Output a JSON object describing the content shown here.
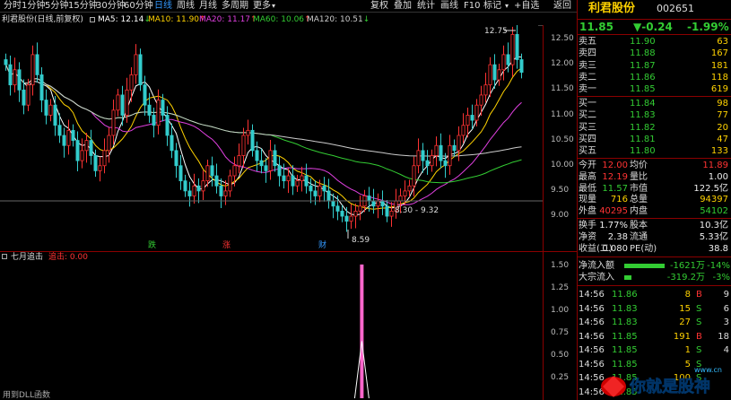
{
  "toolbar": {
    "tabs": [
      "分时",
      "1分钟",
      "5分钟",
      "15分钟",
      "30分钟",
      "60分钟",
      "日线",
      "周线",
      "月线",
      "多周期",
      "更多"
    ],
    "active_tab": "日线",
    "buttons": [
      "复权",
      "叠加",
      "统计",
      "画线",
      "F10",
      "标记",
      "+自选",
      "返回"
    ]
  },
  "chart": {
    "title": "利君股份(日线,前复权)",
    "ma": [
      {
        "label": "MA5: 12.14",
        "arrow": "↓",
        "color": "#ffffff"
      },
      {
        "label": "MA10: 11.90",
        "arrow": "↑",
        "color": "#ffd200"
      },
      {
        "label": "MA20: 11.17",
        "arrow": "↑",
        "color": "#e040e0"
      },
      {
        "label": "MA60: 10.06",
        "arrow": "↑",
        "color": "#33cc33"
      },
      {
        "label": "MA120: 10.51",
        "arrow": "↓",
        "color": "#cccccc"
      }
    ],
    "yaxis": [
      "12.50",
      "12.00",
      "11.50",
      "11.00",
      "10.50",
      "10.00",
      "9.50",
      "9.00"
    ],
    "annotations": {
      "high": "12.75",
      "low": "8.59",
      "range": "8.30 - 9.32"
    },
    "markers": [
      {
        "text": "跌",
        "color": "#33cc33"
      },
      {
        "text": "涨",
        "color": "#ff3333"
      },
      {
        "text": "财",
        "color": "#3399ff"
      }
    ]
  },
  "indicator": {
    "name": "七月追击",
    "label": "追击: 0.00",
    "yaxis": [
      "1.50",
      "1.25",
      "1.00",
      "0.75",
      "0.50",
      "0.25"
    ],
    "footer": "用到DLL函数"
  },
  "panel": {
    "name": "利君股份",
    "code": "002651",
    "price": "11.85",
    "change": "▼-0.24",
    "pct": "-1.99%",
    "asks": [
      {
        "label": "卖五",
        "price": "11.90",
        "vol": "63"
      },
      {
        "label": "卖四",
        "price": "11.88",
        "vol": "167"
      },
      {
        "label": "卖三",
        "price": "11.87",
        "vol": "181"
      },
      {
        "label": "卖二",
        "price": "11.86",
        "vol": "118"
      },
      {
        "label": "卖一",
        "price": "11.85",
        "vol": "619"
      }
    ],
    "bids": [
      {
        "label": "买一",
        "price": "11.84",
        "vol": "98"
      },
      {
        "label": "买二",
        "price": "11.83",
        "vol": "77"
      },
      {
        "label": "买三",
        "price": "11.82",
        "vol": "20"
      },
      {
        "label": "买四",
        "price": "11.81",
        "vol": "47"
      },
      {
        "label": "买五",
        "price": "11.80",
        "vol": "133"
      }
    ],
    "stats": [
      {
        "l1": "今开",
        "v1": "12.00",
        "c1": "#ff3333",
        "l2": "均价",
        "v2": "11.89",
        "c2": "#ff3333"
      },
      {
        "l1": "最高",
        "v1": "12.19",
        "c1": "#ff3333",
        "l2": "量比",
        "v2": "1.00",
        "c2": "#eeeeee"
      },
      {
        "l1": "最低",
        "v1": "11.57",
        "c1": "#33cc33",
        "l2": "市值",
        "v2": "122.5亿",
        "c2": "#eeeeee"
      },
      {
        "l1": "现量",
        "v1": "716",
        "c1": "#ffd200",
        "l2": "总量",
        "v2": "94397",
        "c2": "#ffd200"
      },
      {
        "l1": "外盘",
        "v1": "40295",
        "c1": "#ff3333",
        "l2": "内盘",
        "v2": "54102",
        "c2": "#33cc33"
      }
    ],
    "stats2": [
      {
        "l1": "换手",
        "v1": "1.77%",
        "l2": "股本",
        "v2": "10.3亿"
      },
      {
        "l1": "净资",
        "v1": "2.38",
        "l2": "流通",
        "v2": "5.33亿"
      },
      {
        "l1": "收益(二)",
        "v1": "0.080",
        "l2": "PE(动)",
        "v2": "38.8"
      }
    ],
    "flows": [
      {
        "label": "净流入额",
        "value": "-1621万",
        "pct": "-14%",
        "bar": 0.8
      },
      {
        "label": "大宗流入",
        "value": "-319.2万",
        "pct": "-3%",
        "bar": 0.15
      }
    ],
    "ticks": [
      {
        "time": "14:56",
        "price": "11.86",
        "vol": "8",
        "side": "B"
      },
      {
        "time": "14:56",
        "price": "11.83",
        "vol": "15",
        "side": "S"
      },
      {
        "time": "14:56",
        "price": "11.83",
        "vol": "27",
        "side": "S"
      },
      {
        "time": "14:56",
        "price": "11.85",
        "vol": "191",
        "side": "B"
      },
      {
        "time": "14:56",
        "price": "11.85",
        "vol": "1",
        "side": "S"
      },
      {
        "time": "14:56",
        "price": "11.85",
        "vol": "5",
        "side": "S"
      },
      {
        "time": "14:56",
        "price": "11.85",
        "vol": "100",
        "side": "S"
      },
      {
        "time": "14:56",
        "price": "11.85",
        "vol": "",
        "side": ""
      }
    ],
    "tick_extra": [
      "9",
      "6",
      "3",
      "18",
      "4",
      "",
      ""
    ]
  },
  "watermark": {
    "text": "你就是股神",
    "site": "www.cn"
  }
}
